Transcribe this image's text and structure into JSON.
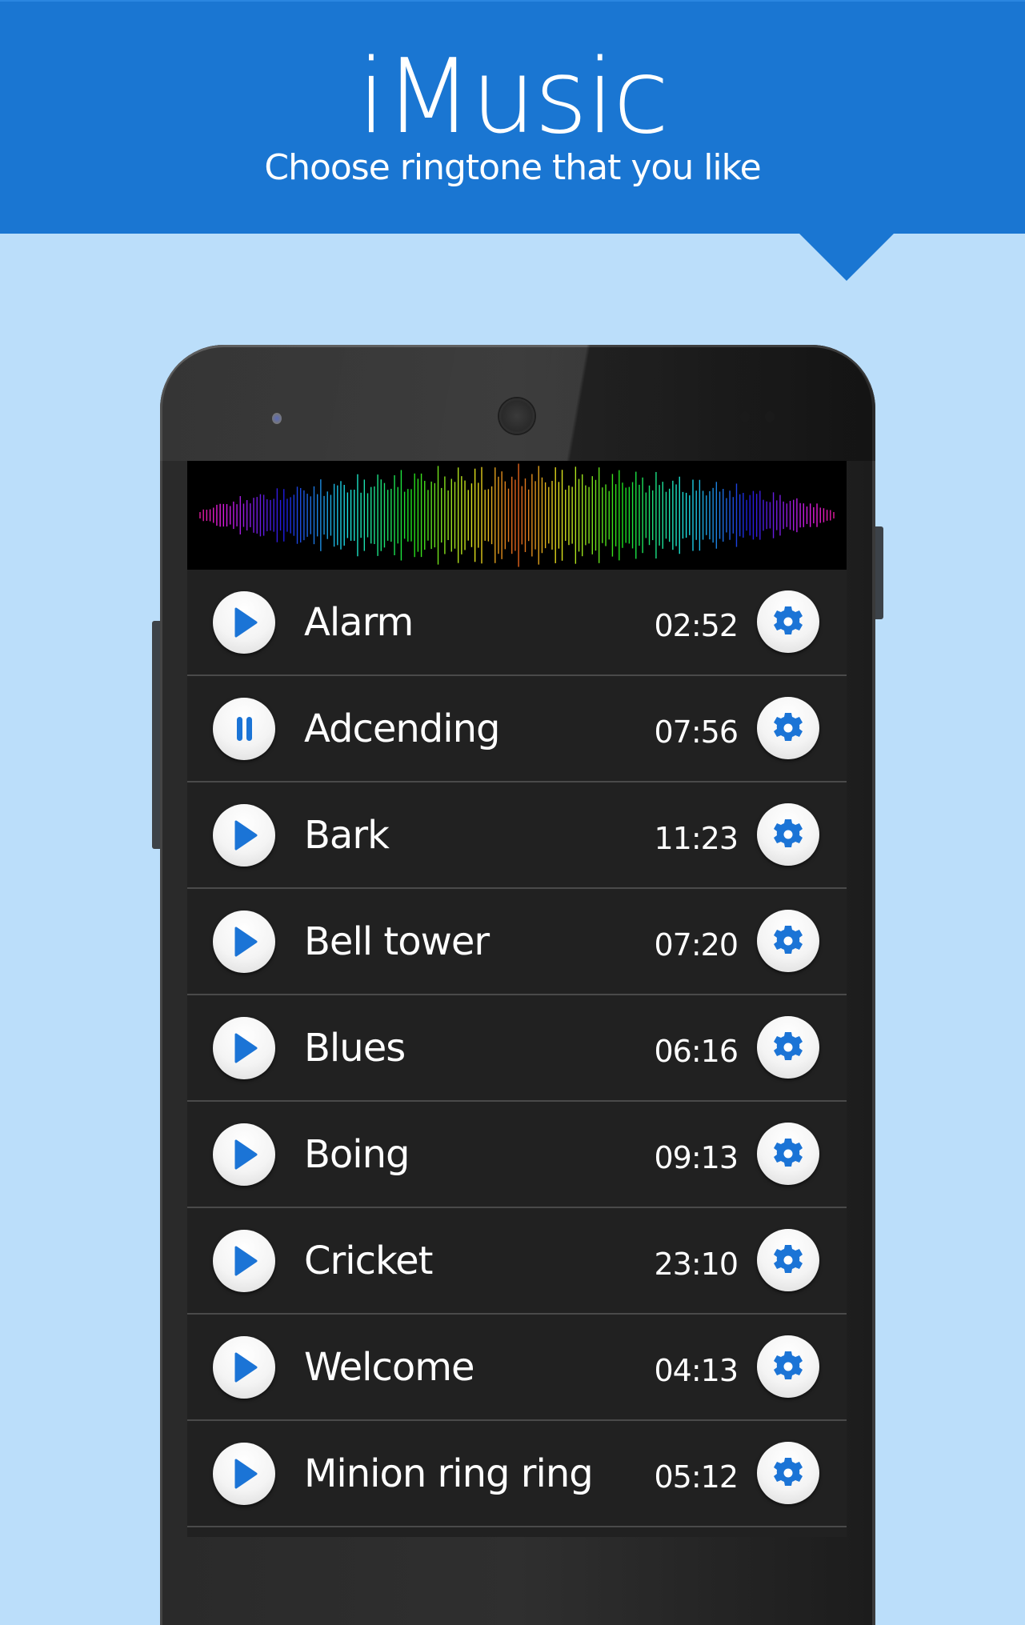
{
  "header": {
    "title": "iMusic",
    "subtitle": "Choose ringtone that you like"
  },
  "colors": {
    "header_blue": "#1a76d2",
    "background_light_blue": "#bbdefa",
    "icon_blue": "#1b74d6",
    "list_background": "#212121"
  },
  "icons": {
    "play": "play-icon",
    "pause": "pause-icon",
    "settings": "gear-icon"
  },
  "ringtones": [
    {
      "name": "Alarm",
      "duration": "02:52",
      "state": "stopped"
    },
    {
      "name": "Adcending",
      "duration": "07:56",
      "state": "playing"
    },
    {
      "name": "Bark",
      "duration": "11:23",
      "state": "stopped"
    },
    {
      "name": "Bell tower",
      "duration": "07:20",
      "state": "stopped"
    },
    {
      "name": "Blues",
      "duration": "06:16",
      "state": "stopped"
    },
    {
      "name": "Boing",
      "duration": "09:13",
      "state": "stopped"
    },
    {
      "name": "Cricket",
      "duration": "23:10",
      "state": "stopped"
    },
    {
      "name": "Welcome",
      "duration": "04:13",
      "state": "stopped"
    },
    {
      "name": "Minion ring ring",
      "duration": "05:12",
      "state": "stopped"
    }
  ]
}
